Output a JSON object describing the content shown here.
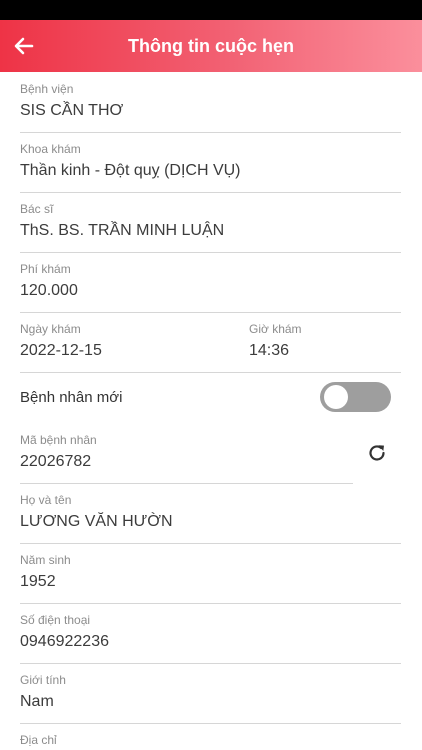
{
  "header": {
    "title": "Thông tin cuộc hẹn",
    "back_icon": "arrow-left-icon"
  },
  "colors": {
    "header_start": "#ee3346",
    "header_end": "#fb8f9c",
    "toggle_off": "#9e9e9e"
  },
  "form": {
    "hospital": {
      "label": "Bệnh viện",
      "value": "SIS CẦN THƠ"
    },
    "department": {
      "label": "Khoa khám",
      "value": "Thần kinh - Đột quỵ (DỊCH VỤ)"
    },
    "doctor": {
      "label": "Bác sĩ",
      "value": "ThS. BS. TRẦN MINH LUẬN"
    },
    "fee": {
      "label": "Phí khám",
      "value": "120.000"
    },
    "date": {
      "label": "Ngày khám",
      "value": "2022-12-15"
    },
    "time": {
      "label": "Giờ khám",
      "value": "14:36"
    },
    "new_patient": {
      "label": "Bệnh nhân mới",
      "on": false
    },
    "patient_id": {
      "label": "Mã bệnh nhân",
      "value": "22026782",
      "refresh_icon": "refresh-icon"
    },
    "full_name": {
      "label": "Họ và tên",
      "value": "LƯƠNG VĂN HƯỜN"
    },
    "birth_year": {
      "label": "Năm sinh",
      "value": "1952"
    },
    "phone": {
      "label": "Số điện thoại",
      "value": "0946922236"
    },
    "gender": {
      "label": "Giới tính",
      "value": "Nam"
    },
    "address": {
      "label": "Địa chỉ"
    }
  }
}
